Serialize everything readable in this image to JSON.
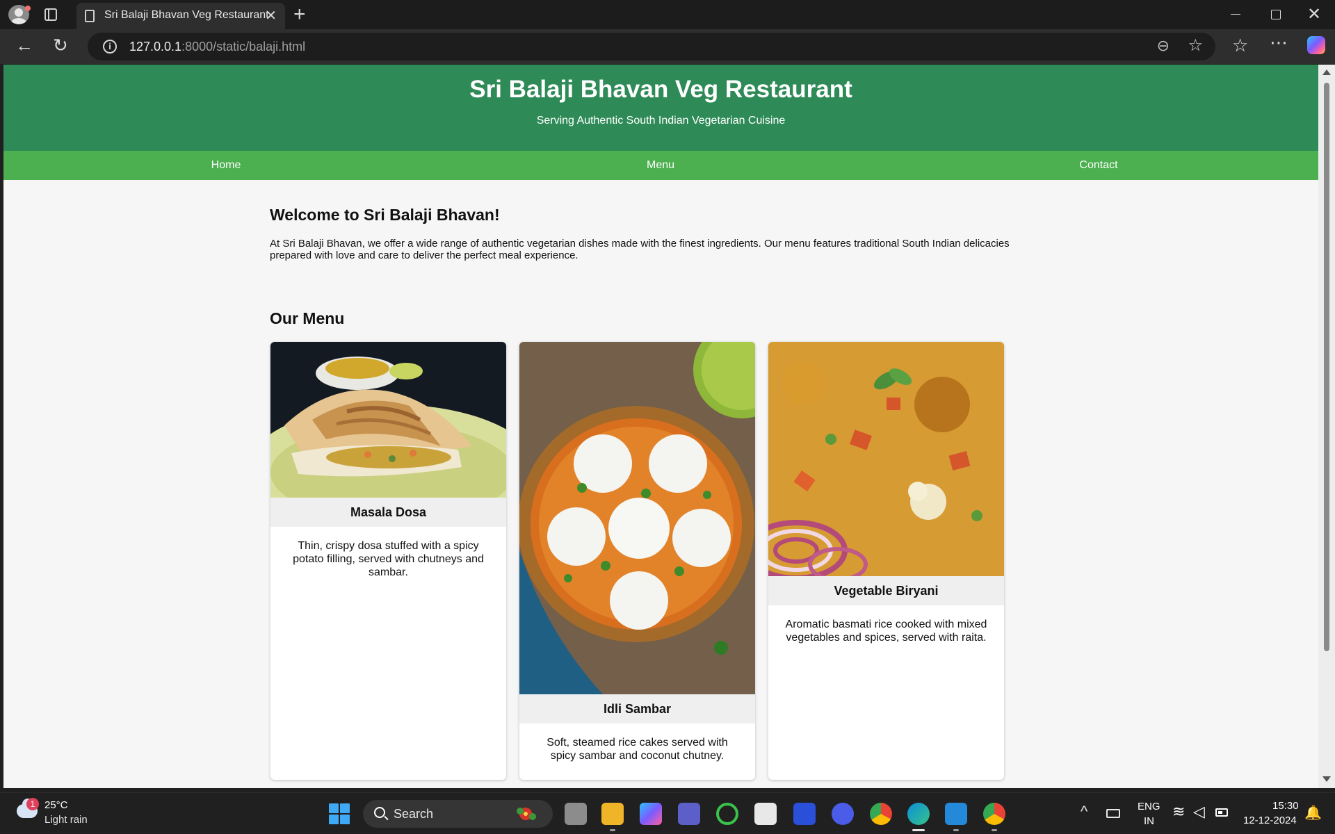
{
  "browser": {
    "tab_title": "Sri Balaji Bhavan Veg Restaurant",
    "url_host": "127.0.0.1",
    "url_rest": ":8000/static/balaji.html"
  },
  "site": {
    "title": "Sri Balaji Bhavan Veg Restaurant",
    "subtitle": "Serving Authentic South Indian Vegetarian Cuisine",
    "nav": [
      "Home",
      "Menu",
      "Contact"
    ],
    "welcome_heading": "Welcome to Sri Balaji Bhavan!",
    "welcome_text": "At Sri Balaji Bhavan, we offer a wide range of authentic vegetarian dishes made with the finest ingredients. Our menu features traditional South Indian delicacies prepared with love and care to deliver the perfect meal experience.",
    "menu_heading": "Our Menu",
    "dishes": [
      {
        "name": "Masala Dosa",
        "description": "Thin, crispy dosa stuffed with a spicy potato filling, served with chutneys and sambar."
      },
      {
        "name": "Idli Sambar",
        "description": "Soft, steamed rice cakes served with spicy sambar and coconut chutney."
      },
      {
        "name": "Vegetable Biryani",
        "description": "Aromatic basmati rice cooked with mixed vegetables and spices, served with raita."
      }
    ]
  },
  "colors": {
    "header_green": "#2e8b57",
    "nav_green": "#4caf50"
  },
  "taskbar": {
    "weather_badge": "1",
    "weather_temp": "25°C",
    "weather_desc": "Light rain",
    "search_label": "Search",
    "lang_line1": "ENG",
    "lang_line2": "IN",
    "time": "15:30",
    "date": "12-12-2024"
  }
}
